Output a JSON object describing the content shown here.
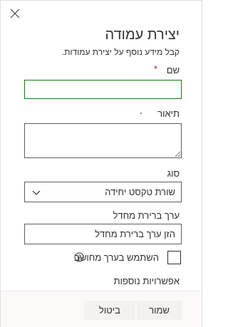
{
  "panel": {
    "title": "יצירת עמודה",
    "subtitle": "קבל מידע נוסף על יצירת עמודות.",
    "close_icon": "close-icon"
  },
  "fields": {
    "name": {
      "label": "שם",
      "required_mark": "*",
      "value": ""
    },
    "description": {
      "label": "תיאור",
      "value": ""
    },
    "type": {
      "label": "סוג",
      "selected": "שורת טקסט יחידה",
      "icon": "chevron-down-icon"
    },
    "default_value": {
      "label": "ערך ברירת מחדל",
      "placeholder": "הזן ערך ברירת מחדל"
    },
    "calculated": {
      "label": "השתמש בערך מחושב",
      "checked": false,
      "icon": "info-icon"
    }
  },
  "more_options": "אפשרויות נוספות",
  "footer": {
    "save_label": "שמור",
    "cancel_label": "ביטול"
  },
  "colors": {
    "focus_border": "#107c10",
    "required": "#a4262c",
    "button_bg": "#f3f2f1"
  }
}
